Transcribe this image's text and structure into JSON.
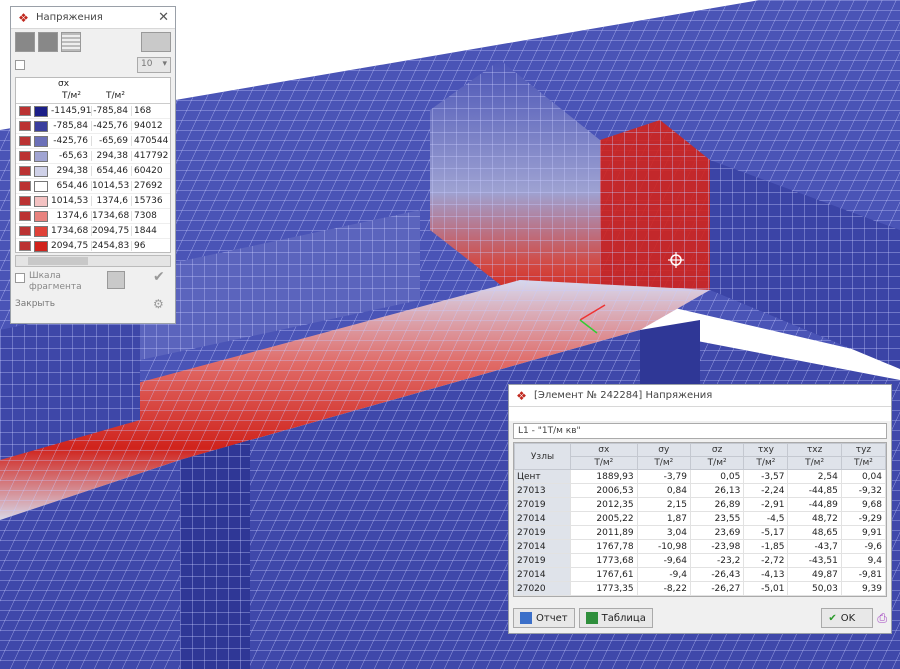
{
  "legend_window": {
    "title": "Напряжения",
    "count_select": "10",
    "header_symbol": "σx",
    "unit": "Т/м²",
    "rows": [
      {
        "from": "-1145,91",
        "to": "-785,84",
        "count": "168",
        "color": "#1c1f88"
      },
      {
        "from": "-785,84",
        "to": "-425,76",
        "count": "94012",
        "color": "#3a3f9e"
      },
      {
        "from": "-425,76",
        "to": "-65,69",
        "count": "470544",
        "color": "#6b70b8"
      },
      {
        "from": "-65,63",
        "to": "294,38",
        "count": "417792",
        "color": "#a0a4d2"
      },
      {
        "from": "294,38",
        "to": "654,46",
        "count": "60420",
        "color": "#cfd1e8"
      },
      {
        "from": "654,46",
        "to": "1014,53",
        "count": "27692",
        "color": "#ffffff"
      },
      {
        "from": "1014,53",
        "to": "1374,6",
        "count": "15736",
        "color": "#f3c2c2"
      },
      {
        "from": "1374,6",
        "to": "1734,68",
        "count": "7308",
        "color": "#e8837f"
      },
      {
        "from": "1734,68",
        "to": "2094,75",
        "count": "1844",
        "color": "#e04238"
      },
      {
        "from": "2094,75",
        "to": "2454,83",
        "count": "96",
        "color": "#d0231c"
      }
    ],
    "fragment_label_1": "Шкала",
    "fragment_label_2": "фрагмента",
    "close_label": "Закрыть"
  },
  "result_window": {
    "title": "[Элемент № 242284] Напряжения",
    "load_case": "L1 - \"1T/м кв\"",
    "node_header": "Узлы",
    "columns": [
      {
        "sym": "σx",
        "unit": "Т/м²"
      },
      {
        "sym": "σy",
        "unit": "Т/м²"
      },
      {
        "sym": "σz",
        "unit": "Т/м²"
      },
      {
        "sym": "τxy",
        "unit": "Т/м²"
      },
      {
        "sym": "τxz",
        "unit": "Т/м²"
      },
      {
        "sym": "τyz",
        "unit": "Т/м²"
      }
    ],
    "rows": [
      {
        "node": "Цент",
        "vals": [
          "1889,93",
          "-3,79",
          "0,05",
          "-3,57",
          "2,54",
          "0,04"
        ]
      },
      {
        "node": "27013",
        "vals": [
          "2006,53",
          "0,84",
          "26,13",
          "-2,24",
          "-44,85",
          "-9,32"
        ]
      },
      {
        "node": "27019",
        "vals": [
          "2012,35",
          "2,15",
          "26,89",
          "-2,91",
          "-44,89",
          "9,68"
        ]
      },
      {
        "node": "27014",
        "vals": [
          "2005,22",
          "1,87",
          "23,55",
          "-4,5",
          "48,72",
          "-9,29"
        ]
      },
      {
        "node": "27019",
        "vals": [
          "2011,89",
          "3,04",
          "23,69",
          "-5,17",
          "48,65",
          "9,91"
        ]
      },
      {
        "node": "27014",
        "vals": [
          "1767,78",
          "-10,98",
          "-23,98",
          "-1,85",
          "-43,7",
          "-9,6"
        ]
      },
      {
        "node": "27019",
        "vals": [
          "1773,68",
          "-9,64",
          "-23,2",
          "-2,72",
          "-43,51",
          "9,4"
        ]
      },
      {
        "node": "27014",
        "vals": [
          "1767,61",
          "-9,4",
          "-26,43",
          "-4,13",
          "49,87",
          "-9,81"
        ]
      },
      {
        "node": "27020",
        "vals": [
          "1773,35",
          "-8,22",
          "-26,27",
          "-5,01",
          "50,03",
          "9,39"
        ]
      }
    ],
    "report_label": "Отчет",
    "table_label": "Таблица",
    "ok_label": "OK"
  },
  "colors": {
    "mesh_blue": "#4a54b6",
    "mesh_dark": "#2b2f8c",
    "stress_red": "#d0231c"
  }
}
